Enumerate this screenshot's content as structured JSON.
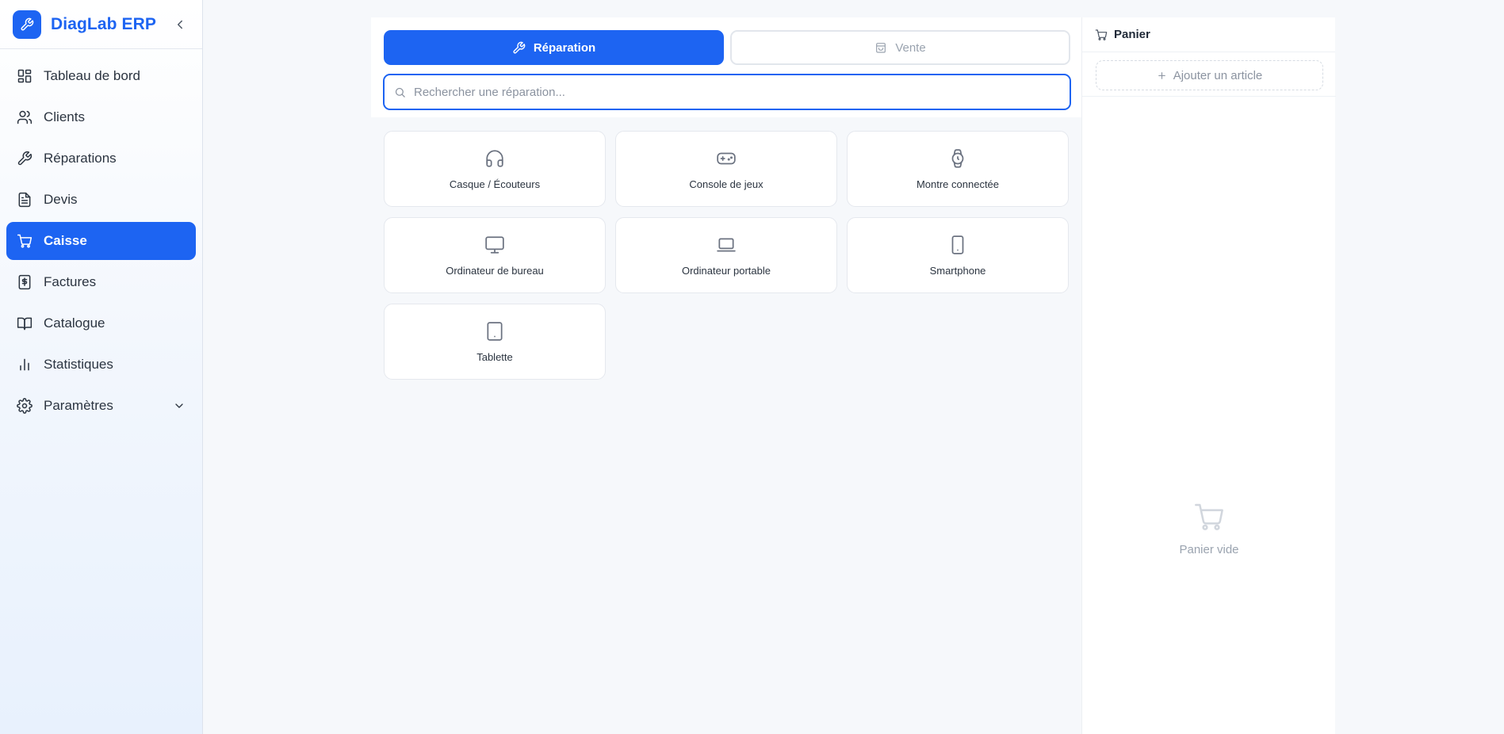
{
  "app": {
    "name": "DiagLab ERP"
  },
  "sidebar": {
    "items": [
      {
        "label": "Tableau de bord",
        "icon": "dashboard-icon"
      },
      {
        "label": "Clients",
        "icon": "users-icon"
      },
      {
        "label": "Réparations",
        "icon": "wrench-icon"
      },
      {
        "label": "Devis",
        "icon": "document-icon"
      },
      {
        "label": "Caisse",
        "icon": "cart-icon",
        "active": true
      },
      {
        "label": "Factures",
        "icon": "invoice-dollar-icon"
      },
      {
        "label": "Catalogue",
        "icon": "book-icon"
      },
      {
        "label": "Statistiques",
        "icon": "bar-chart-icon"
      },
      {
        "label": "Paramètres",
        "icon": "gear-icon",
        "expandable": true
      }
    ]
  },
  "pos": {
    "tabs": [
      {
        "label": "Réparation",
        "icon": "wrench-icon",
        "active": true
      },
      {
        "label": "Vente",
        "icon": "shopping-bag-icon",
        "active": false
      }
    ],
    "search": {
      "placeholder": "Rechercher une réparation...",
      "value": ""
    },
    "categories": [
      {
        "label": "Casque / Écouteurs",
        "icon": "headphones-icon"
      },
      {
        "label": "Console de jeux",
        "icon": "gamepad-icon"
      },
      {
        "label": "Montre connectée",
        "icon": "watch-icon"
      },
      {
        "label": "Ordinateur de bureau",
        "icon": "monitor-icon"
      },
      {
        "label": "Ordinateur portable",
        "icon": "laptop-icon"
      },
      {
        "label": "Smartphone",
        "icon": "smartphone-icon"
      },
      {
        "label": "Tablette",
        "icon": "tablet-icon"
      }
    ]
  },
  "cart": {
    "title": "Panier",
    "add_label": "Ajouter un article",
    "empty_label": "Panier vide"
  },
  "colors": {
    "accent": "#1d64f2",
    "muted": "#9aa3af"
  }
}
